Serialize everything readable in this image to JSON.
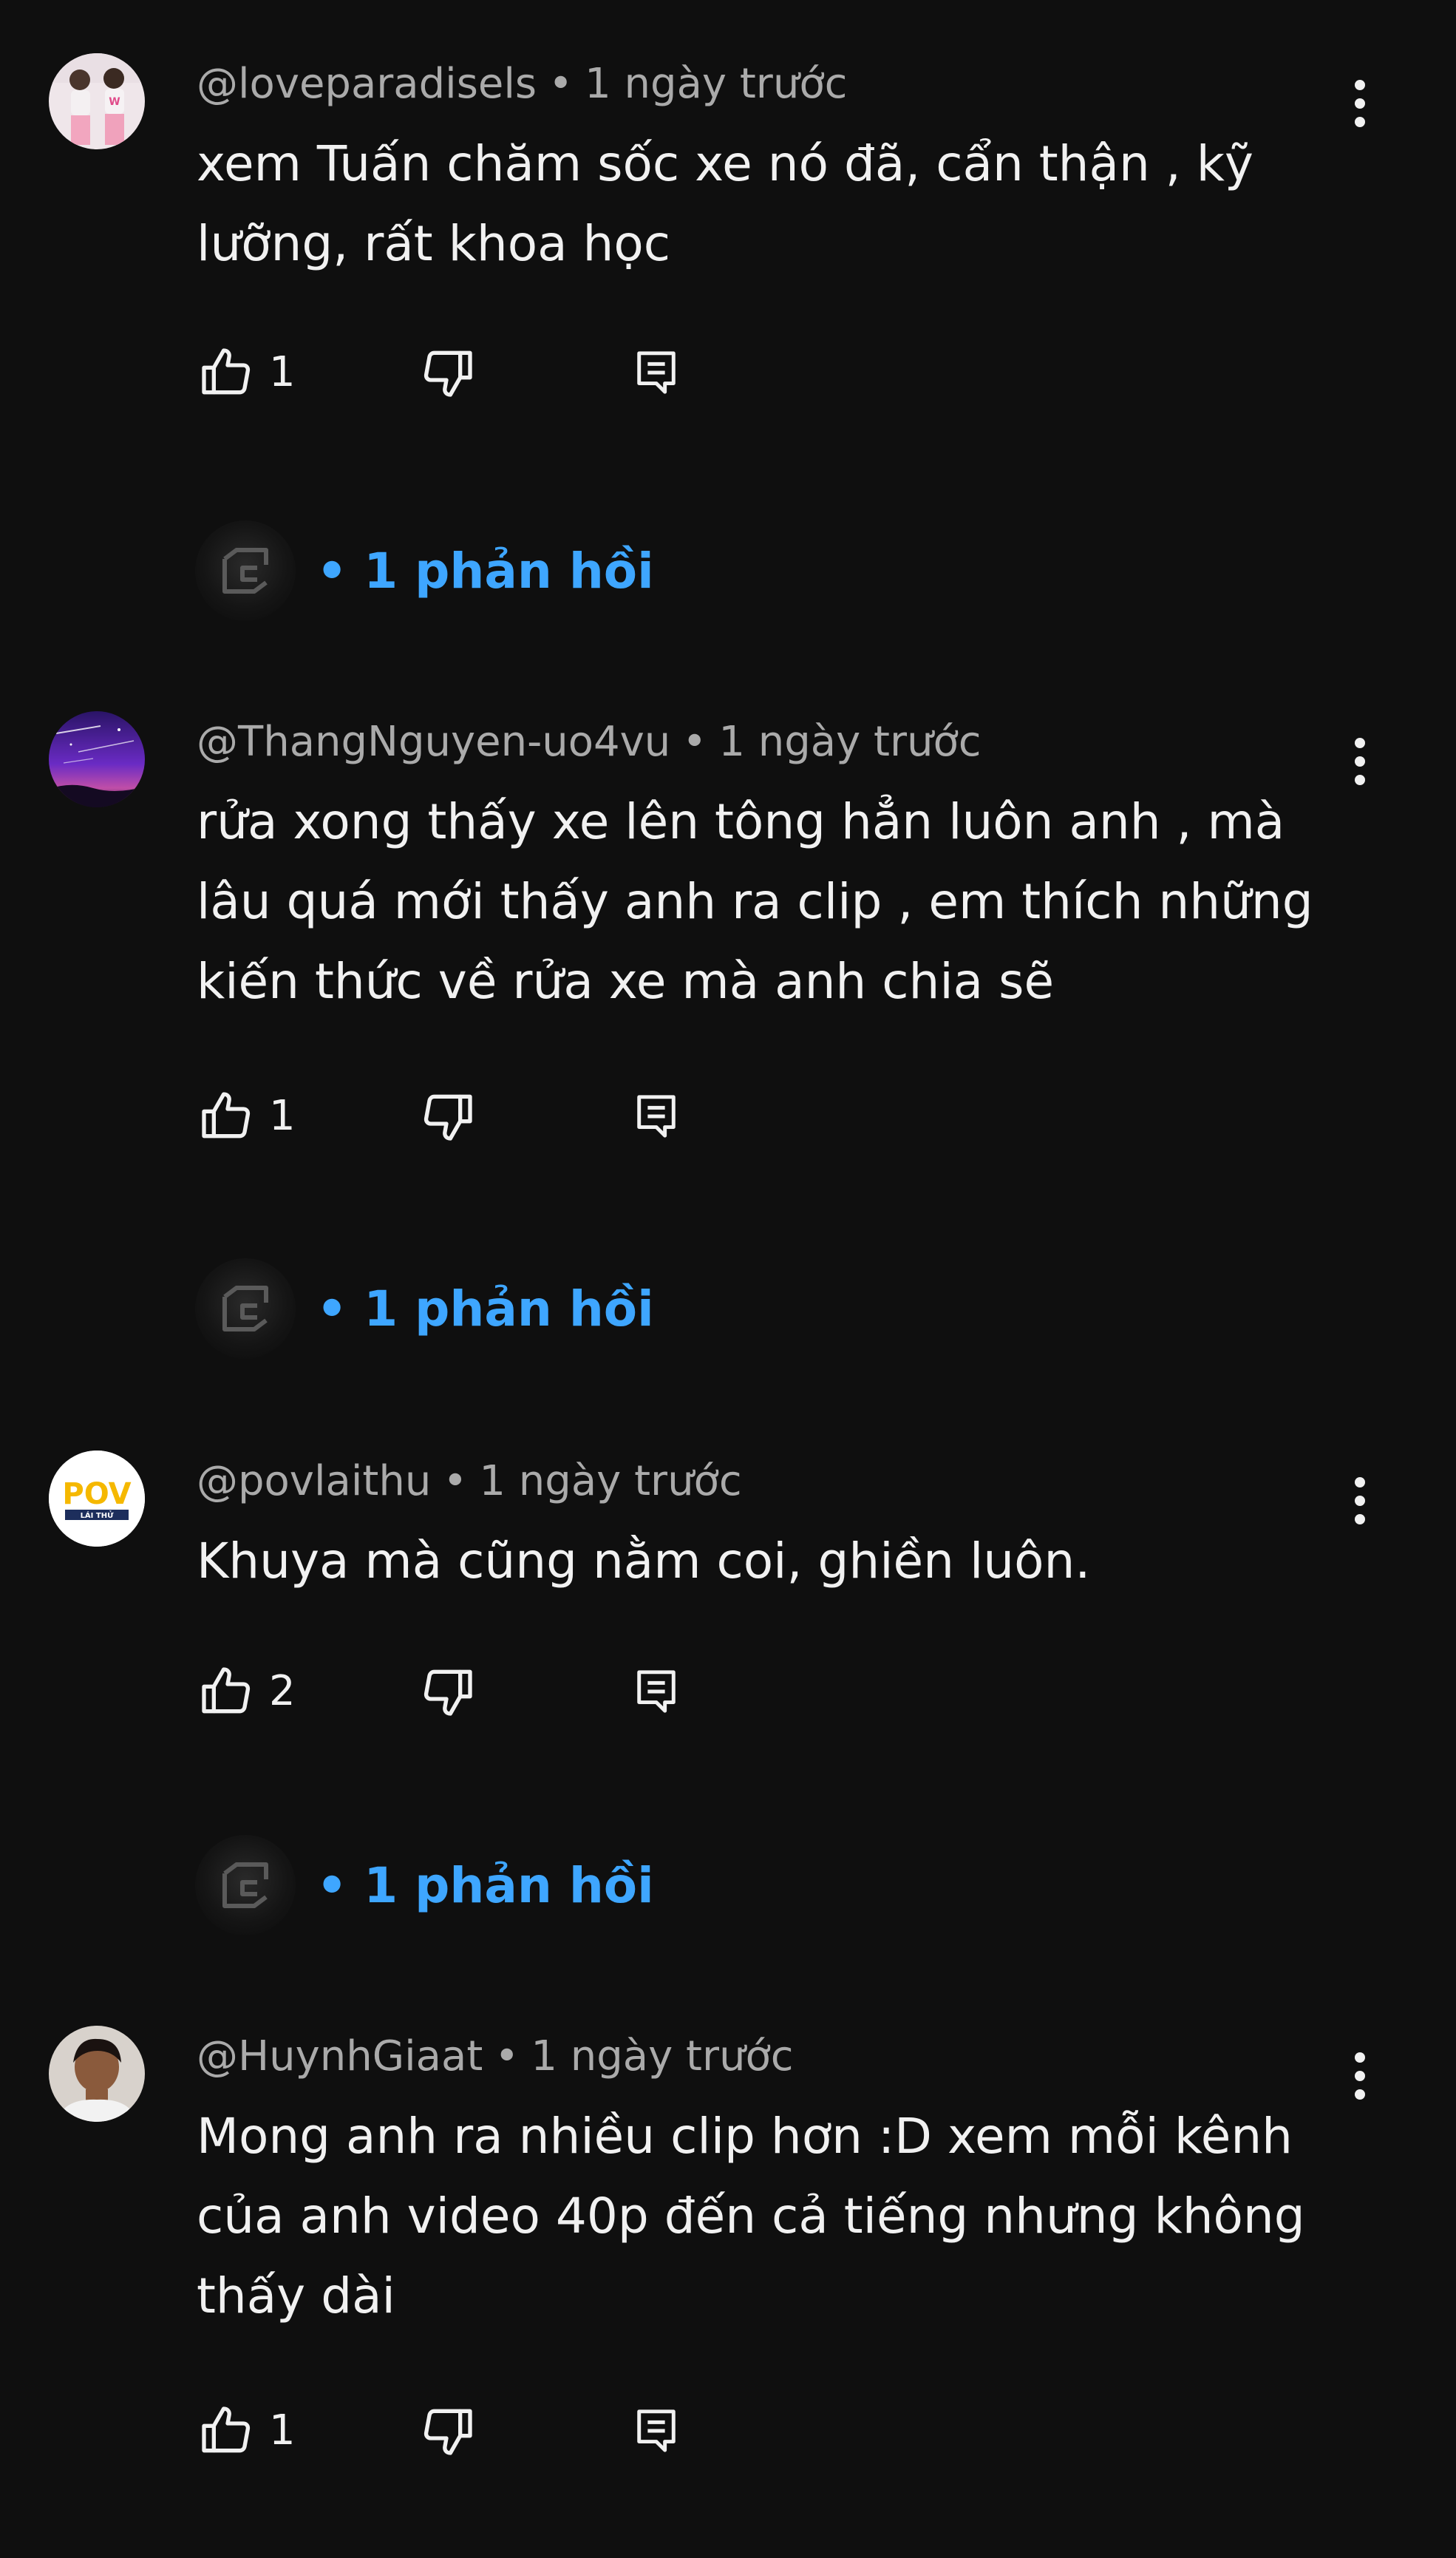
{
  "comments": [
    {
      "author": "@loveparadisels",
      "separator": "•",
      "time": "1 ngày trước",
      "lines": [
        "xem Tuấn chăm sốc xe nó đã, cẩn thận , kỹ",
        "lưỡng, rất khoa học"
      ],
      "likes": "1",
      "replies_dot": "•",
      "replies": "1 phản hồi",
      "avatar_icon": "girl-photo-avatar"
    },
    {
      "author": "@ThangNguyen-uo4vu",
      "separator": "•",
      "time": "1 ngày trước",
      "lines": [
        "rửa xong thấy xe lên tông hẳn luôn anh , mà",
        "lâu quá mới thấy anh ra clip , em thích những",
        "kiến thức về rửa xe mà anh chia sẽ"
      ],
      "likes": "1",
      "replies_dot": "•",
      "replies": "1 phản hồi",
      "avatar_icon": "starry-sky-avatar"
    },
    {
      "author": "@povlaithu",
      "separator": "•",
      "time": "1 ngày trước",
      "lines": [
        "Khuya mà cũng nằm coi, ghiền luôn."
      ],
      "likes": "2",
      "replies_dot": "•",
      "replies": "1 phản hồi",
      "avatar_icon": "pov-logo-avatar",
      "avatar_logo_text": "POV",
      "avatar_logo_sub": "LÁI THỬ"
    },
    {
      "author": "@HuynhGiaat",
      "separator": "•",
      "time": "1 ngày trước",
      "lines": [
        "Mong anh ra nhiều clip hơn :D xem mỗi kênh",
        "của anh video 40p đến cả tiếng nhưng không",
        "thấy dài"
      ],
      "likes": "1",
      "avatar_icon": "man-photo-avatar"
    }
  ],
  "colors": {
    "background": "#0f0f0f",
    "text_primary": "#f1f1f1",
    "text_secondary": "#aaaaaa",
    "link_blue": "#3ea6ff",
    "pov_yellow": "#f5b800",
    "pov_navy": "#1d2e5c"
  },
  "icons": {
    "like": "thumb-up-icon",
    "dislike": "thumb-down-icon",
    "reply": "comment-reply-icon",
    "more": "more-vertical-icon",
    "channel": "channel-logo-icon"
  }
}
